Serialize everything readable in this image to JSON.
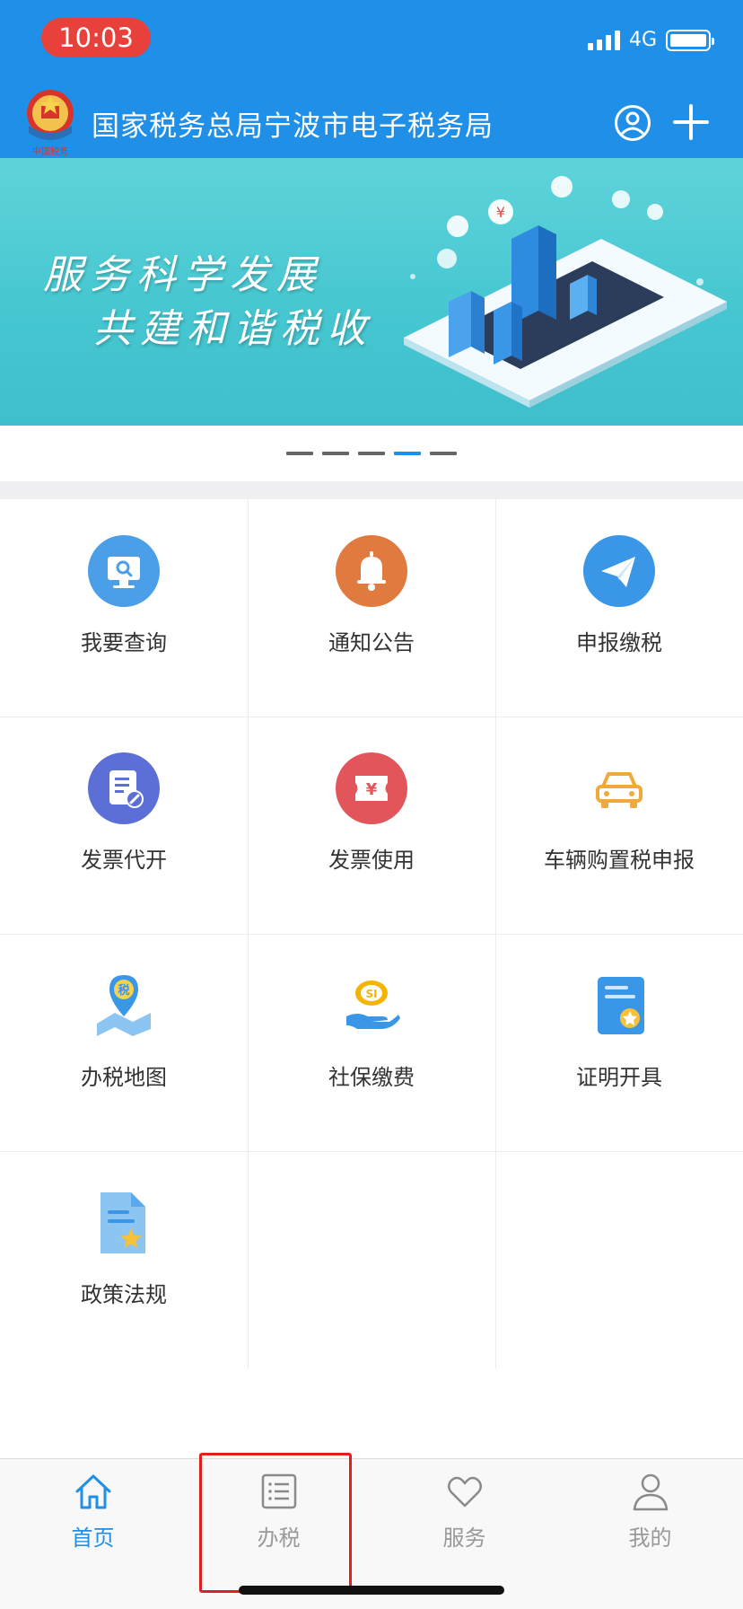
{
  "status_bar": {
    "time": "10:03",
    "network": "4G"
  },
  "header": {
    "title": "国家税务总局宁波市电子税务局",
    "emblem_text": "中国税务"
  },
  "banner": {
    "slogan_line1": "服务科学发展",
    "slogan_line2": "共建和谐税收",
    "slide_count": 5,
    "active_slide": 4
  },
  "colors": {
    "header_blue": "#1f8fe8",
    "time_pill_red": "#e8413c",
    "highlight_red": "#e02020"
  },
  "grid": {
    "items": [
      {
        "label": "我要查询",
        "icon": "search-monitor-icon"
      },
      {
        "label": "通知公告",
        "icon": "bell-icon"
      },
      {
        "label": "申报缴税",
        "icon": "paper-plane-icon"
      },
      {
        "label": "发票代开",
        "icon": "invoice-edit-icon"
      },
      {
        "label": "发票使用",
        "icon": "yuan-ticket-icon"
      },
      {
        "label": "车辆购置税申报",
        "icon": "car-icon"
      },
      {
        "label": "办税地图",
        "icon": "map-pin-icon"
      },
      {
        "label": "社保缴费",
        "icon": "social-security-hand-icon"
      },
      {
        "label": "证明开具",
        "icon": "certificate-icon"
      },
      {
        "label": "政策法规",
        "icon": "policy-document-icon"
      }
    ]
  },
  "tabbar": {
    "tabs": [
      {
        "label": "首页",
        "icon": "home-icon",
        "active": true
      },
      {
        "label": "办税",
        "icon": "list-icon",
        "active": false
      },
      {
        "label": "服务",
        "icon": "heart-icon",
        "active": false
      },
      {
        "label": "我的",
        "icon": "person-icon",
        "active": false
      }
    ]
  }
}
